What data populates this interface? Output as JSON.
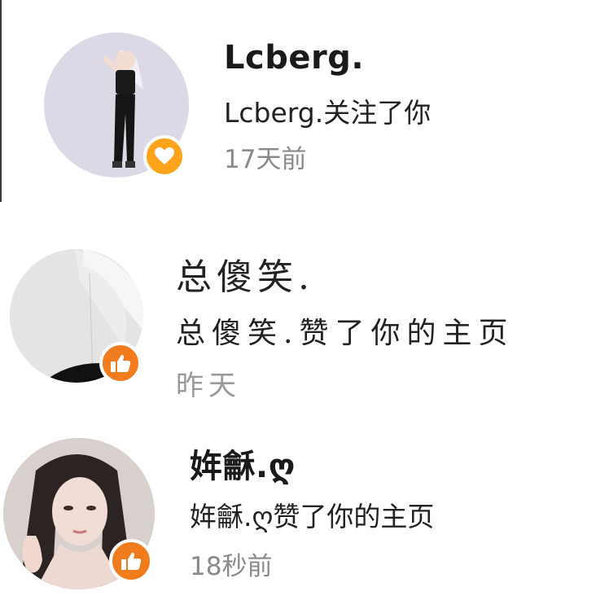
{
  "notifications": [
    {
      "username": "Lcberg.",
      "message": "Lcberg.关注了你",
      "time": "17天前",
      "badge_icon": "heart-icon",
      "badge_color": "#ffa31a"
    },
    {
      "username": "总傻笑.",
      "message": "总傻笑.赞了你的主页",
      "time": "昨天",
      "badge_icon": "thumbs-up-icon",
      "badge_color": "#f07c1e"
    },
    {
      "username": "姩龢.ღ",
      "message": "姩龢.ღ赞了你的主页",
      "time": "18秒前",
      "badge_icon": "thumbs-up-icon",
      "badge_color": "#f07c1e"
    }
  ]
}
